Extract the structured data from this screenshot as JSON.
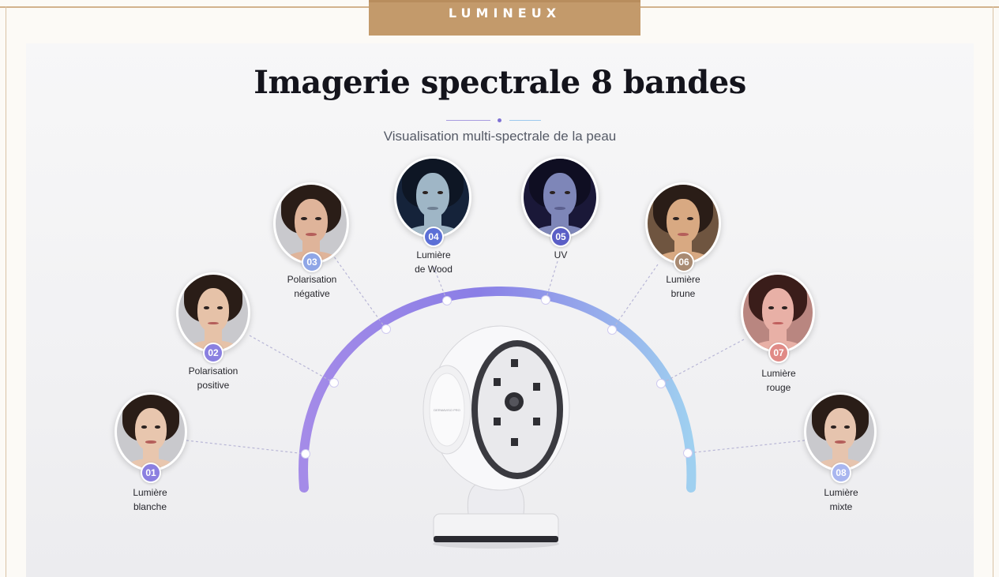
{
  "brand": {
    "name": "LUMINEUX"
  },
  "header": {
    "title": "Imagerie spectrale 8 bandes",
    "subtitle": "Visualisation multi-spectrale de la peau"
  },
  "colors": {
    "accent_gold": "#c39a6b",
    "arc_start": "#a48be8",
    "arc_end": "#9fd0f0"
  },
  "bands": [
    {
      "number": "01",
      "label_line1": "Lumière",
      "label_line2": "blanche",
      "badge_color": "#8b7fe0",
      "tint": "#e8c6ae"
    },
    {
      "number": "02",
      "label_line1": "Polarisation",
      "label_line2": "positive",
      "badge_color": "#8a80e0",
      "tint": "#e6c2a8"
    },
    {
      "number": "03",
      "label_line1": "Polarisation",
      "label_line2": "négative",
      "badge_color": "#8fa6e6",
      "tint": "#dfb49a"
    },
    {
      "number": "04",
      "label_line1": "Lumière",
      "label_line2": "de Wood",
      "badge_color": "#5b6fd6",
      "tint": "#9fb6c6"
    },
    {
      "number": "05",
      "label_line1": "UV",
      "label_line2": "",
      "badge_color": "#5a5ec6",
      "tint": "#7e86b8"
    },
    {
      "number": "06",
      "label_line1": "Lumière",
      "label_line2": "brune",
      "badge_color": "#a88a72",
      "tint": "#d8a982"
    },
    {
      "number": "07",
      "label_line1": "Lumière",
      "label_line2": "rouge",
      "badge_color": "#e08a86",
      "tint": "#e8b0a6"
    },
    {
      "number": "08",
      "label_line1": "Lumière",
      "label_line2": "mixte",
      "badge_color": "#a9b6ef",
      "tint": "#e6c4ae"
    }
  ],
  "device": {
    "panel_text": "DERMAVISO PRO"
  }
}
